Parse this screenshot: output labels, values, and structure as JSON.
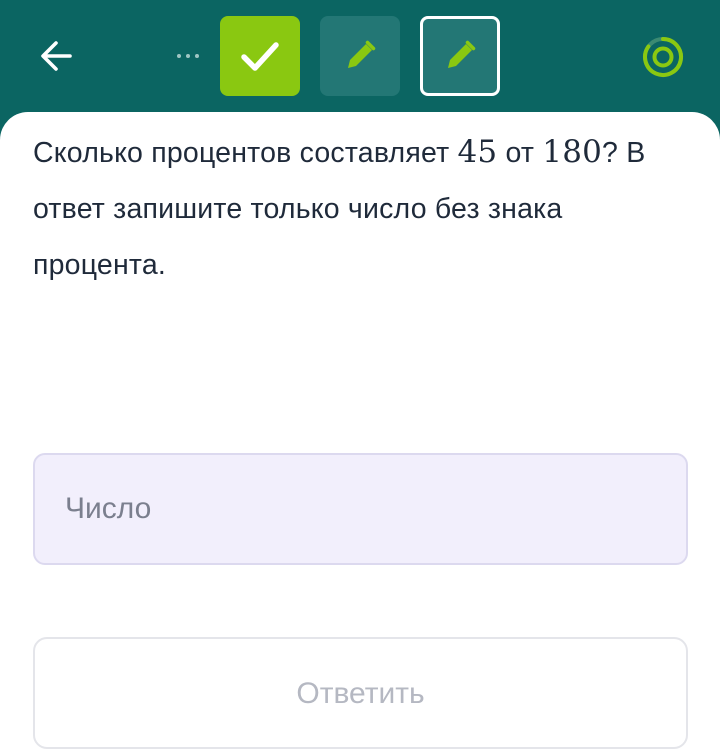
{
  "colors": {
    "header_bg": "#0b6562",
    "step_done": "#8ac811",
    "step_pending": "#237775",
    "accent_green": "#8ac811",
    "input_bg": "#f2effc",
    "text_primary": "#1f2a3a",
    "button_text_disabled": "#b5b8c2"
  },
  "header": {
    "back_icon": "arrow-left-icon",
    "more_icon": "more-dots-icon",
    "steps": [
      {
        "state": "done",
        "icon": "checkmark-icon"
      },
      {
        "state": "pending",
        "icon": "pencil-icon"
      },
      {
        "state": "current",
        "icon": "pencil-icon"
      }
    ],
    "progress_icon": "progress-ring-icon"
  },
  "question": {
    "text_before": "Сколько процентов составляет ",
    "number_a": "45",
    "text_middle": " от ",
    "number_b": "180",
    "text_after": "? В ответ запишите только число без знака процента."
  },
  "answer": {
    "placeholder": "Число",
    "value": ""
  },
  "submit": {
    "label": "Ответить",
    "enabled": false
  }
}
